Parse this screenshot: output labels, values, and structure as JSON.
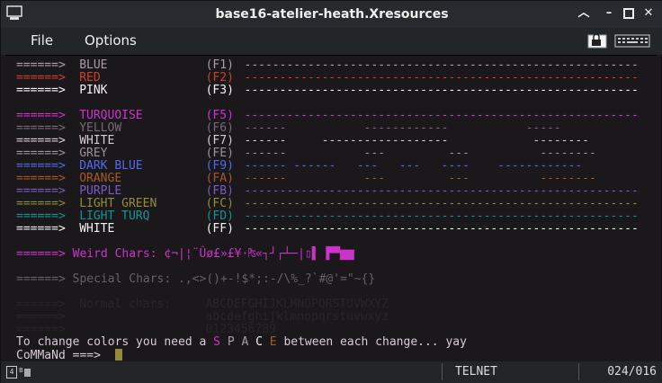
{
  "window": {
    "title": "base16-atelier-heath.Xresources"
  },
  "menu": {
    "file": "File",
    "options": "Options"
  },
  "terminal": {
    "lines": [
      {
        "arrow": "======>",
        "name": "BLUE",
        "key": "(F1)",
        "dashes": "--------------------------------------------------------",
        "c": "#ab9bab"
      },
      {
        "arrow": "======>",
        "name": "RED",
        "key": "(F2)",
        "dashes": "--------------------------------------------------------",
        "c": "#ca402b"
      },
      {
        "arrow": "======>",
        "name": "PINK",
        "key": "(F3)",
        "dashes": "--------------------------------------------------------",
        "c": "#f7f3f7"
      },
      {
        "arrow": "",
        "name": "",
        "key": "",
        "dashes": "",
        "c": "#292329"
      },
      {
        "arrow": "======>",
        "name": "TURQUOISE",
        "key": "(F5)",
        "dashes": "--------------------------------------------------------",
        "c": "#cc33cc"
      },
      {
        "arrow": "======>",
        "name": "YELLOW",
        "key": "(F6)",
        "dashes": "------           ------------           -----",
        "c": "#776977"
      },
      {
        "arrow": "======>",
        "name": "WHITE",
        "key": "(F7)",
        "dashes": "------     ------------------            --------",
        "c": "#d8cad8"
      },
      {
        "arrow": "======>",
        "name": "GREY",
        "key": "(FE)",
        "dashes": "------           ---         ---          --------",
        "c": "#9e8f9e"
      },
      {
        "arrow": "======>",
        "name": "DARK BLUE",
        "key": "(F9)",
        "dashes": "------ ------   ---   ---   ----    ------------",
        "c": "#516aec"
      },
      {
        "arrow": "======>",
        "name": "ORANGE",
        "key": "(FA)",
        "dashes": "------           ---         ---          --------",
        "c": "#a65926"
      },
      {
        "arrow": "======>",
        "name": "PURPLE",
        "key": "(FB)",
        "dashes": "--------------------------------------------------------",
        "c": "#7b59c0"
      },
      {
        "arrow": "======>",
        "name": "LIGHT GREEN",
        "key": "(FC)",
        "dashes": "--------------------------------------------------------",
        "c": "#918b3b"
      },
      {
        "arrow": "======>",
        "name": "LIGHT TURQ",
        "key": "(FD)",
        "dashes": "--------------------------------------------------------",
        "c": "#159393"
      },
      {
        "arrow": "======>",
        "name": "WHITE",
        "key": "(FF)",
        "dashes": "--------------------------------------------------------",
        "c": "#f7f3f7"
      }
    ],
    "weird": {
      "arrow": "======>",
      "label": "Weird Chars:",
      "chars": "¢¬|¦¨Ûø£»£¥·₧«┐┘┌┴─|▯▌ ▛▀▆▆",
      "c": "#cc33cc"
    },
    "special": {
      "arrow": "======>",
      "label": "Special Chars:",
      "chars": ".,<>()+-!$*;:-/\\%_?`#@'=\"~{}",
      "c": "#695d69"
    },
    "normal": {
      "arrow": "======>",
      "label": "Normal chars:",
      "upper": "ABCDEFGHIJKLMNOPQRSTUVWXYZ",
      "lower": "abcdefghijklmnopqrstuvwxyz",
      "digits": "0123456789",
      "c": "#292329"
    },
    "change": {
      "before": "To change colors you need a",
      "letters": [
        {
          "t": "S",
          "c": "#cc33cc"
        },
        {
          "t": "P",
          "c": "#ab9bab"
        },
        {
          "t": "A",
          "c": "#ab9bab"
        },
        {
          "t": "C",
          "c": "#f7f3f7"
        },
        {
          "t": "E",
          "c": "#a65926"
        }
      ],
      "after": "between each change... yay",
      "c": "#d8cad8"
    },
    "prompt": {
      "text": "CoMMaNd ===>",
      "c": "#d8cad8",
      "cursor_color": "#918b3b"
    }
  },
  "status": {
    "mode": "TELNET",
    "position": "024/016"
  }
}
